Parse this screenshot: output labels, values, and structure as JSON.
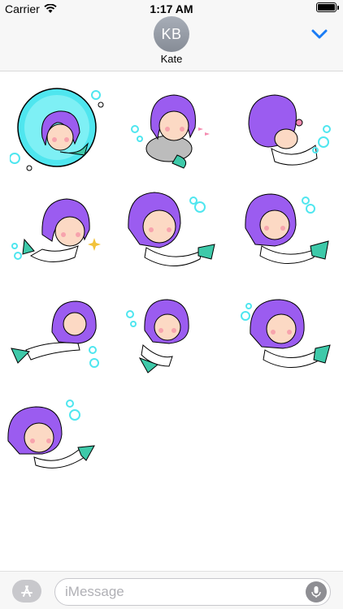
{
  "status_bar": {
    "carrier": "Carrier",
    "time": "1:17 AM",
    "battery_level": 1.0
  },
  "header": {
    "avatar_initials": "KB",
    "contact_name": "Kate",
    "collapse_icon": "chevron-down-icon",
    "accent_color": "#1a7cf5"
  },
  "stickers": [
    {
      "name": "mermaid-in-bubble",
      "bubble": true
    },
    {
      "name": "mermaid-on-rock-with-fish"
    },
    {
      "name": "mermaid-holding-shell-side-view"
    },
    {
      "name": "mermaid-sparkles-tail-left"
    },
    {
      "name": "mermaid-praying-hands"
    },
    {
      "name": "mermaid-hand-on-cheek"
    },
    {
      "name": "mermaid-lying-down"
    },
    {
      "name": "mermaid-small-sitting"
    },
    {
      "name": "mermaid-curious"
    },
    {
      "name": "mermaid-swimming-blushing"
    }
  ],
  "bottom_bar": {
    "apps_icon": "app-store-icon",
    "message_placeholder": "iMessage",
    "message_value": "",
    "mic_icon": "microphone-icon"
  },
  "colors": {
    "hair": "#9b5cf0",
    "tail_fin": "#3ec9a9",
    "bubble": "#4fe6ef",
    "skin": "#fcd9c4",
    "blush": "#f7a3ad",
    "shell_bra": "#4aa7e6"
  }
}
